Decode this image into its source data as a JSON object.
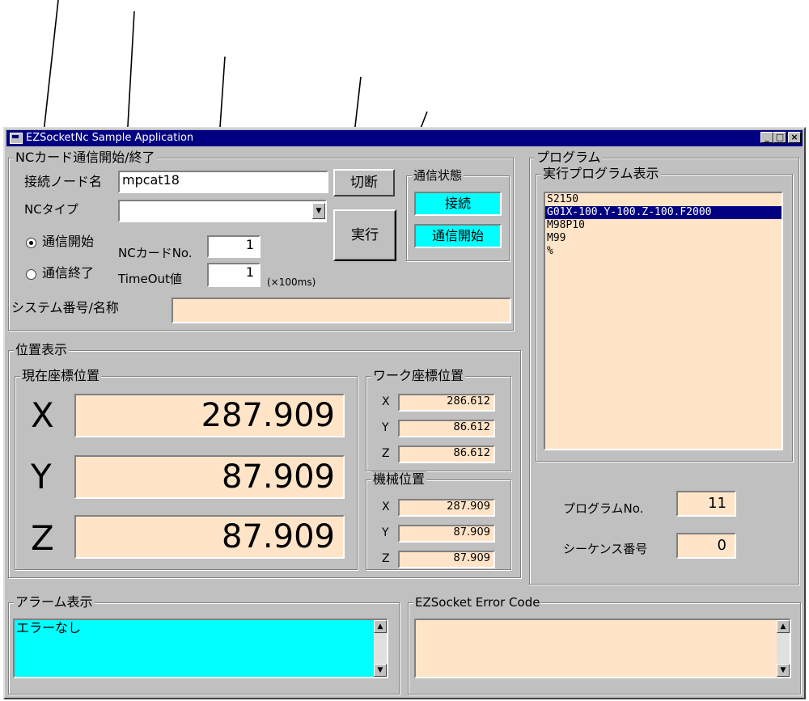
{
  "window": {
    "title": "EZSocketNc Sample Application",
    "controls": [
      "_",
      "□",
      "×"
    ]
  },
  "comm": {
    "group_title": "NCカード通信開始/終了",
    "node_label": "接続ノード名",
    "node_value": "mpcat18",
    "nc_type_label": "NCタイプ",
    "nc_type_value": "",
    "disconnect_button": "切断",
    "execute_button": "実行",
    "radio_start": "通信開始",
    "radio_end": "通信終了",
    "radio_selected": "start",
    "card_no_label": "NCカードNo.",
    "card_no_value": "1",
    "timeout_label": "TimeOut値",
    "timeout_value": "1",
    "timeout_unit": "(×100ms)",
    "system_label": "システム番号/名称",
    "system_value": ""
  },
  "status": {
    "group_title": "通信状態",
    "connected": "接続",
    "comm_started": "通信開始"
  },
  "position": {
    "group_title": "位置表示",
    "current_title": "現在座標位置",
    "current": [
      {
        "axis": "X",
        "value": "287.909"
      },
      {
        "axis": "Y",
        "value": "87.909"
      },
      {
        "axis": "Z",
        "value": "87.909"
      }
    ],
    "work_title": "ワーク座標位置",
    "work": [
      {
        "axis": "X",
        "value": "286.612"
      },
      {
        "axis": "Y",
        "value": "86.612"
      },
      {
        "axis": "Z",
        "value": "86.612"
      }
    ],
    "machine_title": "機械位置",
    "machine": [
      {
        "axis": "X",
        "value": "287.909"
      },
      {
        "axis": "Y",
        "value": "87.909"
      },
      {
        "axis": "Z",
        "value": "87.909"
      }
    ]
  },
  "program": {
    "group_title": "プログラム",
    "exec_title": "実行プログラム表示",
    "lines": [
      "S2150",
      "G01X-100.Y-100.Z-100.F2000",
      "M98P10",
      "M99",
      "%"
    ],
    "selected_index": 1,
    "program_no_label": "プログラムNo.",
    "program_no_value": "11",
    "sequence_label": "シーケンス番号",
    "sequence_value": "0"
  },
  "alarm": {
    "group_title": "アラーム表示",
    "text": "エラーなし"
  },
  "error_code": {
    "group_title": "EZSocket Error Code",
    "text": ""
  },
  "colors": {
    "titlebar": "#000080",
    "face": "#c0c0c0",
    "peach": "#ffe4c8",
    "cyan": "#00ffff"
  }
}
